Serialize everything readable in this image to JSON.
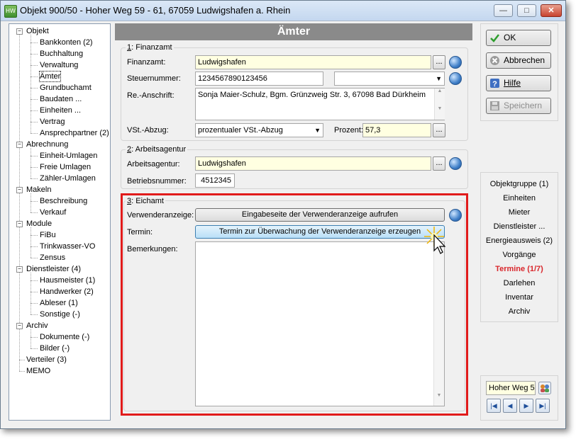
{
  "window": {
    "title": "Objekt 900/50 - Hoher Weg 59 - 61, 67059 Ludwigshafen a. Rhein",
    "app_icon": "app-icon",
    "controls": {
      "minimize": "—",
      "maximize": "□",
      "close": "✕"
    }
  },
  "tree": {
    "items": [
      {
        "label": "Objekt",
        "level": 0
      },
      {
        "label": "Bankkonten (2)",
        "level": 1
      },
      {
        "label": "Buchhaltung",
        "level": 1
      },
      {
        "label": "Verwaltung",
        "level": 1
      },
      {
        "label": "Ämter",
        "level": 1,
        "selected": true
      },
      {
        "label": "Grundbuchamt",
        "level": 1
      },
      {
        "label": "Baudaten ...",
        "level": 1
      },
      {
        "label": "Einheiten ...",
        "level": 1
      },
      {
        "label": "Vertrag",
        "level": 1
      },
      {
        "label": "Ansprechpartner (2)",
        "level": 1
      },
      {
        "label": "Abrechnung",
        "level": 0
      },
      {
        "label": "Einheit-Umlagen",
        "level": 1
      },
      {
        "label": "Freie Umlagen",
        "level": 1
      },
      {
        "label": "Zähler-Umlagen",
        "level": 1
      },
      {
        "label": "Makeln",
        "level": 0
      },
      {
        "label": "Beschreibung",
        "level": 1
      },
      {
        "label": "Verkauf",
        "level": 1
      },
      {
        "label": "Module",
        "level": 0
      },
      {
        "label": "FiBu",
        "level": 1
      },
      {
        "label": "Trinkwasser-VO",
        "level": 1
      },
      {
        "label": "Zensus",
        "level": 1
      },
      {
        "label": "Dienstleister (4)",
        "level": 0
      },
      {
        "label": "Hausmeister (1)",
        "level": 1
      },
      {
        "label": "Handwerker (2)",
        "level": 1
      },
      {
        "label": "Ableser (1)",
        "level": 1
      },
      {
        "label": "Sonstige (-)",
        "level": 1
      },
      {
        "label": "Archiv",
        "level": 0
      },
      {
        "label": "Dokumente (-)",
        "level": 1
      },
      {
        "label": "Bilder (-)",
        "level": 1
      },
      {
        "label": "Verteiler (3)",
        "level": 0,
        "leaf": true
      },
      {
        "label": "MEMO",
        "level": 0,
        "leaf": true
      }
    ],
    "expand_symbol": "−"
  },
  "main": {
    "header": "Ämter",
    "finanzamt": {
      "group_title_num": "1",
      "group_title_text": ": Finanzamt",
      "finanzamt_label": "Finanzamt:",
      "finanzamt_value": "Ludwigshafen",
      "steuernummer_label": "Steuernummer:",
      "steuernummer_value": "1234567890123456",
      "steuer_combo_value": "",
      "anschrift_label": "Re.-Anschrift:",
      "anschrift_value": "Sonja Maier-Schulz, Bgm. Grünzweig Str. 3, 67098 Bad Dürkheim",
      "vst_label": "VSt.-Abzug:",
      "vst_value": "prozentualer VSt.-Abzug",
      "prozent_label": "Prozent:",
      "prozent_value": "57,3"
    },
    "arbeitsagentur": {
      "group_title_num": "2",
      "group_title_text": ": Arbeitsagentur",
      "agentur_label": "Arbeitsagentur:",
      "agentur_value": "Ludwigshafen",
      "betriebsnummer_label": "Betriebsnummer:",
      "betriebsnummer_value": "4512345"
    },
    "eichamt": {
      "group_title_num": "3",
      "group_title_text": ": Eichamt",
      "verwenderanzeige_label": "Verwenderanzeige:",
      "verwenderanzeige_button": "Eingabeseite der Verwenderanzeige aufrufen",
      "termin_label": "Termin:",
      "termin_button": "Termin zur Überwachung der Verwenderanzeige erzeugen",
      "bemerkungen_label": "Bemerkungen:",
      "bemerkungen_value": ""
    },
    "ellipsis": "..."
  },
  "side": {
    "ok": "OK",
    "abbrechen": "Abbrechen",
    "hilfe": "Hilfe",
    "speichern": "Speichern",
    "nav": [
      {
        "label": "Objektgruppe (1)"
      },
      {
        "label": "Einheiten"
      },
      {
        "label": "Mieter"
      },
      {
        "label": "Dienstleister ..."
      },
      {
        "label": "Energieausweis (2)"
      },
      {
        "label": "Vorgänge"
      },
      {
        "label": "Termine (1/7)",
        "active": true
      },
      {
        "label": "Darlehen"
      },
      {
        "label": "Inventar"
      },
      {
        "label": "Archiv"
      }
    ],
    "search_value": "Hoher Weg 5",
    "nav_buttons": {
      "first": "|◀",
      "prev": "◀",
      "next": "▶",
      "last": "▶|"
    }
  },
  "colors": {
    "accent_red": "#e11b1b",
    "active_nav": "#d9262b",
    "header_gray": "#8a8a8a",
    "field_yellow": "#ffffe1"
  }
}
